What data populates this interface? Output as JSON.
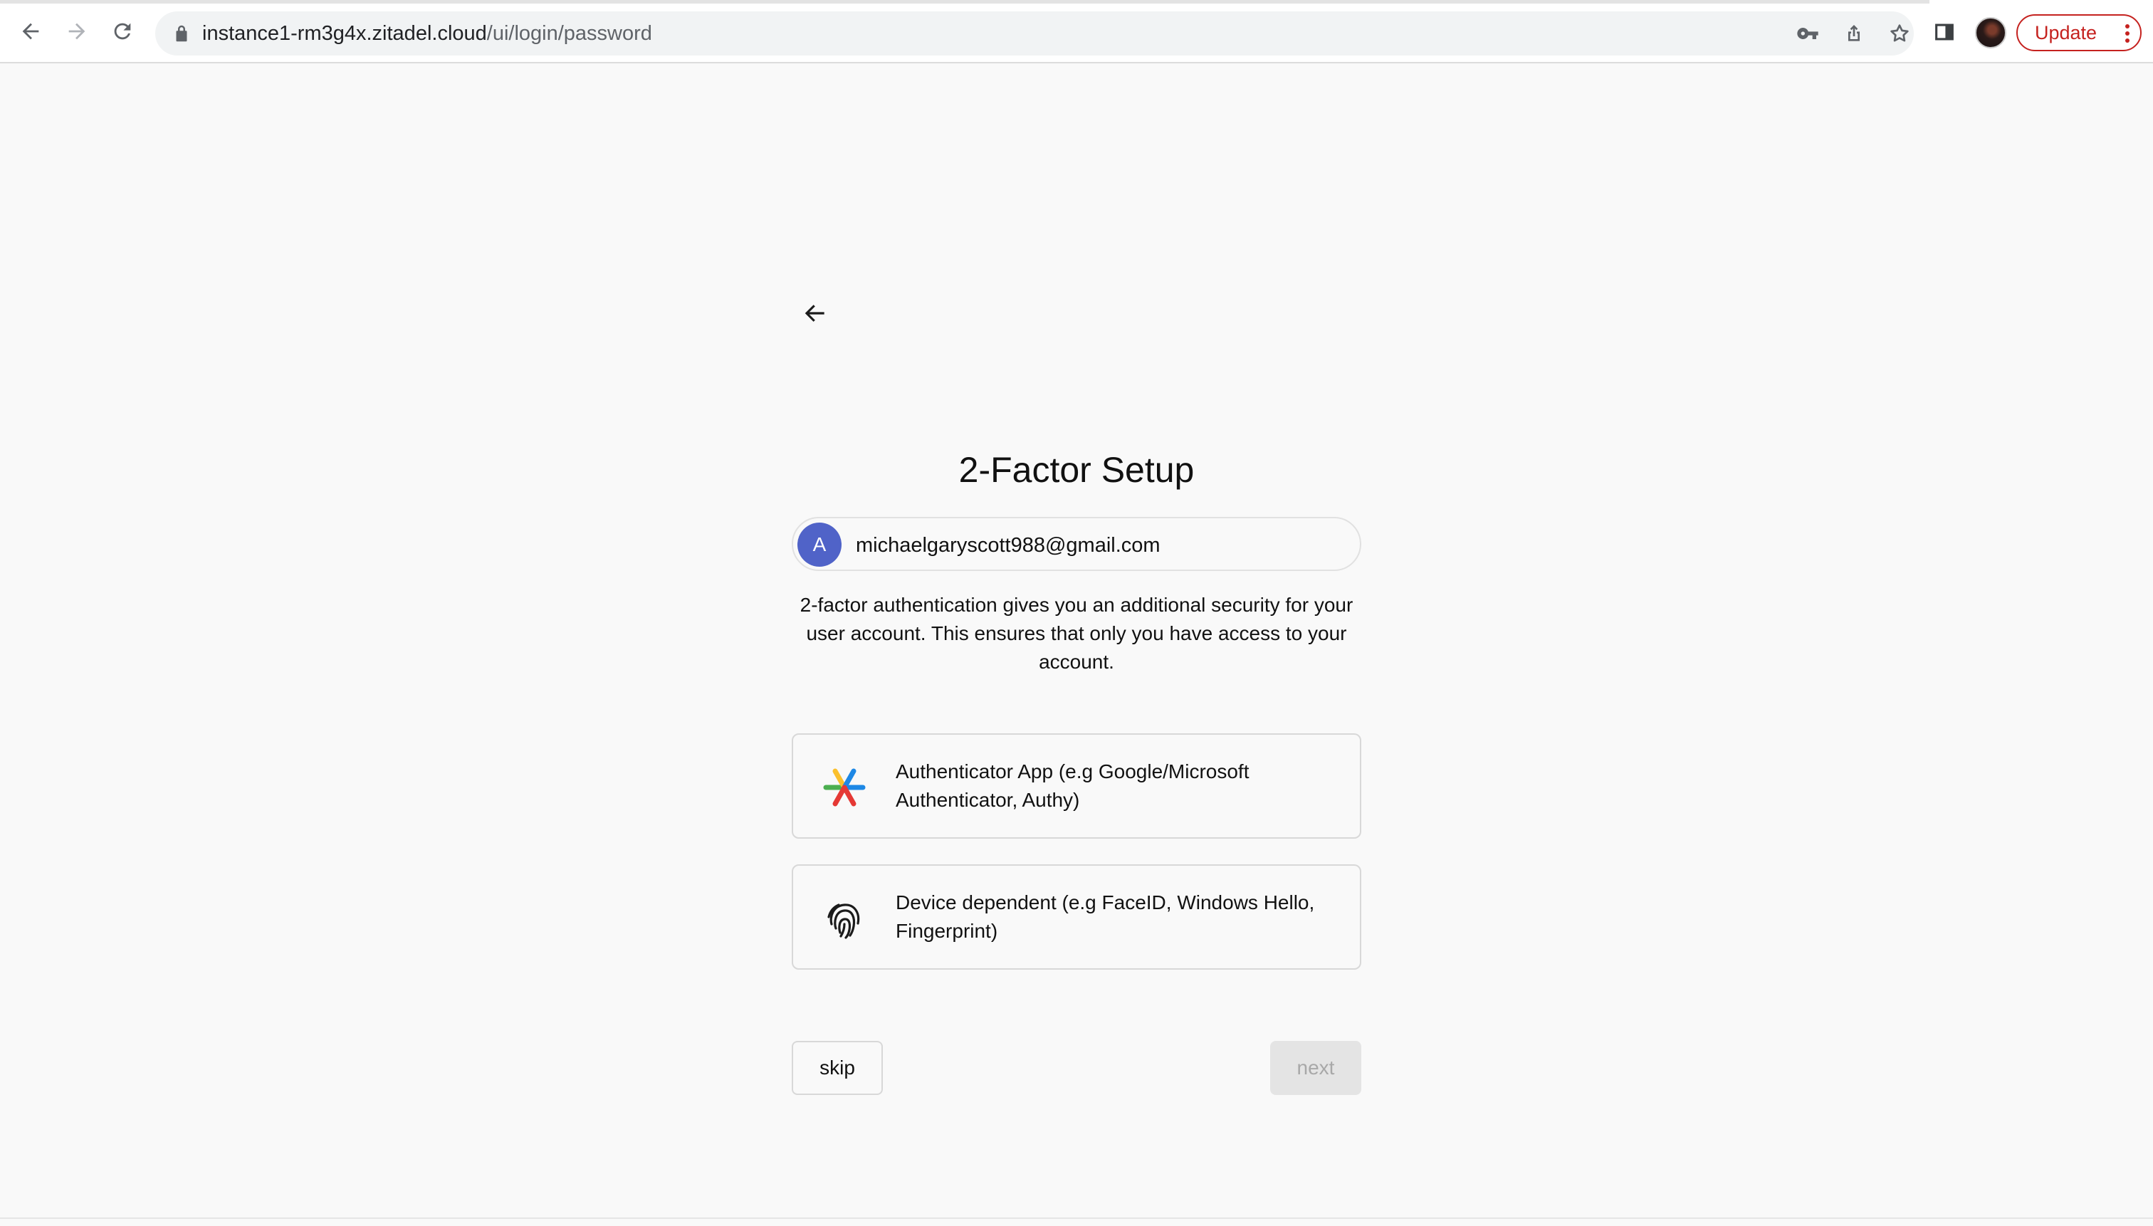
{
  "browser": {
    "url_host": "instance1-rm3g4x.zitadel.cloud",
    "url_path": "/ui/login/password",
    "update_label": "Update",
    "accent_update": "#c5221f",
    "icons": [
      "back-icon",
      "forward-icon",
      "reload-icon",
      "lock-icon",
      "key-icon",
      "share-icon",
      "star-icon",
      "side-panel-icon",
      "profile-avatar",
      "more-vert-icon"
    ]
  },
  "page": {
    "title": "2-Factor Setup",
    "user": {
      "avatar_initial": "A",
      "avatar_color": "#5063c8",
      "email": "michaelgaryscott988@gmail.com"
    },
    "description": "2-factor authentication gives you an additional security for your user account. This ensures that only you have access to your account.",
    "options": [
      {
        "icon": "authenticator-app-icon",
        "label": "Authenticator App (e.g Google/Microsoft Authenticator, Authy)"
      },
      {
        "icon": "fingerprint-icon",
        "label": "Device dependent (e.g FaceID, Windows Hello, Fingerprint)"
      }
    ],
    "buttons": {
      "skip": "skip",
      "next": "next"
    }
  }
}
